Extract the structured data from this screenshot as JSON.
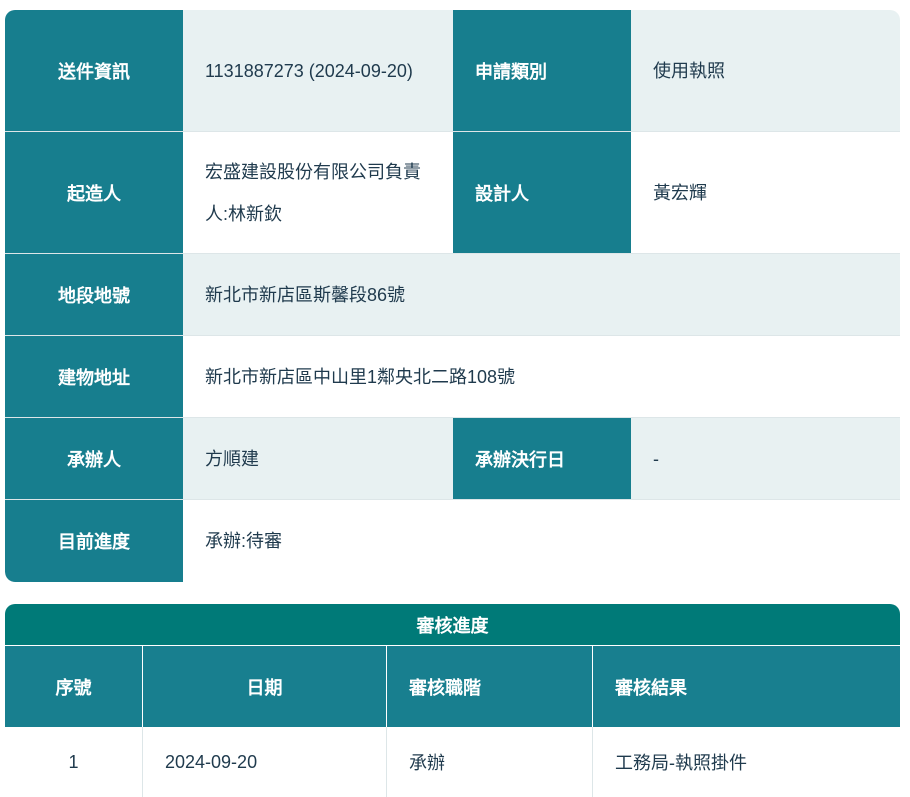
{
  "info": {
    "submission_label": "送件資訊",
    "submission_value": "1131887273 (2024-09-20)",
    "apply_type_label": "申請類別",
    "apply_type_value": "使用執照",
    "builder_label": "起造人",
    "builder_value": "宏盛建設股份有限公司負責人:林新欽",
    "designer_label": "設計人",
    "designer_value": "黃宏輝",
    "lot_label": "地段地號",
    "lot_value": "新北市新店區斯馨段86號",
    "address_label": "建物地址",
    "address_value": "新北市新店區中山里1鄰央北二路108號",
    "handler_label": "承辦人",
    "handler_value": "方順建",
    "decision_date_label": "承辦決行日",
    "decision_date_value": "-",
    "progress_label": "目前進度",
    "progress_value": "承辦:待審"
  },
  "review": {
    "title": "審核進度",
    "headers": [
      "序號",
      "日期",
      "審核職階",
      "審核結果"
    ],
    "rows": [
      [
        "1",
        "2024-09-20",
        "承辦",
        "工務局-執照掛件"
      ]
    ]
  }
}
